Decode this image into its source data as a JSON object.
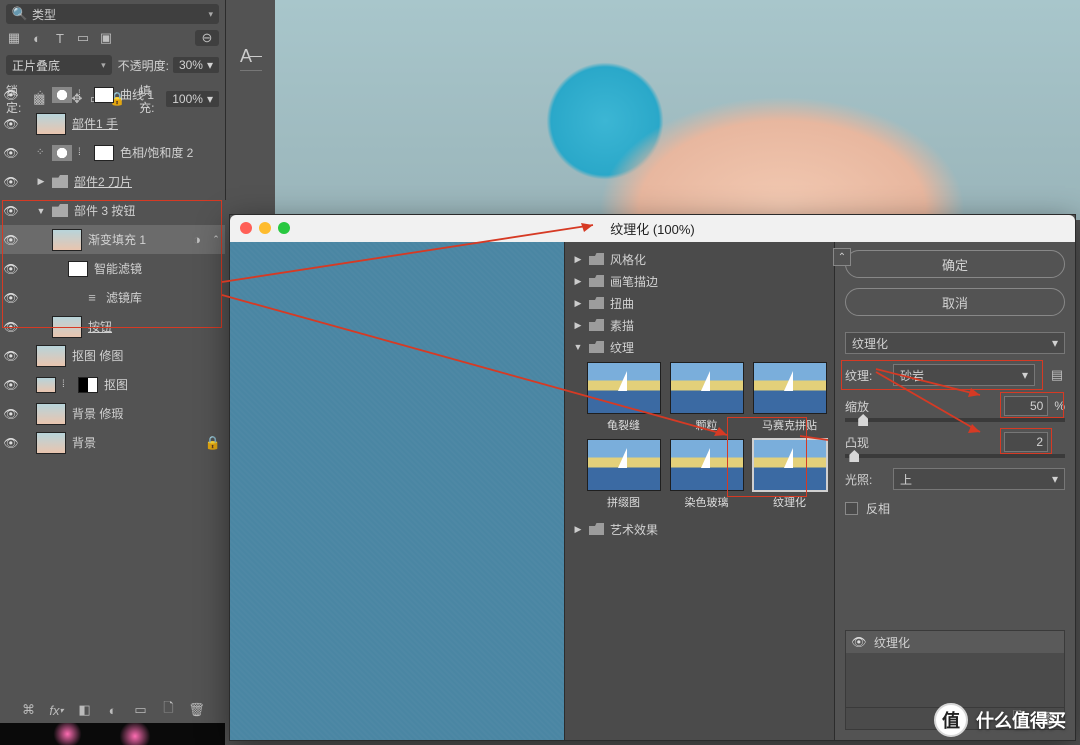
{
  "layers_panel": {
    "search_label": "类型",
    "blend_mode": "正片叠底",
    "opacity_label": "不透明度:",
    "opacity_value": "30%",
    "lock_label": "锁定:",
    "fill_label": "填充:",
    "fill_value": "100%",
    "layers": [
      {
        "name": "曲线 1",
        "kind": "adj",
        "indent": 0,
        "underline": false
      },
      {
        "name": "部件1 手",
        "kind": "smart",
        "indent": 0,
        "underline": true
      },
      {
        "name": "色相/饱和度 2",
        "kind": "adj",
        "indent": 0,
        "underline": false
      },
      {
        "name": "部件2 刀片",
        "kind": "group",
        "indent": 0,
        "underline": true,
        "caret": "▶"
      },
      {
        "name": "部件 3 按钮",
        "kind": "group",
        "indent": 0,
        "underline": false,
        "caret": "▼",
        "open": true
      },
      {
        "name": "渐变填充 1",
        "kind": "smart",
        "indent": 1,
        "underline": false,
        "sel": true,
        "smartbadge": true
      },
      {
        "name": "智能滤镜",
        "kind": "mask",
        "indent": 2,
        "underline": false
      },
      {
        "name": "滤镜库",
        "kind": "text",
        "indent": 3,
        "underline": false
      },
      {
        "name": "按钮",
        "kind": "smart",
        "indent": 1,
        "underline": true
      },
      {
        "name": "抠图 修图",
        "kind": "smart",
        "indent": 0,
        "underline": false
      },
      {
        "name": "抠图",
        "kind": "smartmask",
        "indent": 0,
        "underline": false
      },
      {
        "name": "背景 修瑕",
        "kind": "smart",
        "indent": 0,
        "underline": false
      },
      {
        "name": "背景",
        "kind": "smart",
        "indent": 0,
        "underline": false,
        "locked": true
      }
    ]
  },
  "dialog": {
    "title": "纹理化 (100%)",
    "buttons": {
      "ok": "确定",
      "cancel": "取消"
    },
    "categories": [
      {
        "label": "风格化"
      },
      {
        "label": "画笔描边"
      },
      {
        "label": "扭曲"
      },
      {
        "label": "素描"
      },
      {
        "label": "纹理",
        "open": true,
        "thumbs": [
          {
            "label": "龟裂缝"
          },
          {
            "label": "颗粒"
          },
          {
            "label": "马赛克拼贴"
          },
          {
            "label": "拼缀图"
          },
          {
            "label": "染色玻璃"
          },
          {
            "label": "纹理化",
            "sel": true
          }
        ]
      },
      {
        "label": "艺术效果"
      }
    ],
    "settings": {
      "filter_dropdown": "纹理化",
      "texture_label": "纹理:",
      "texture_value": "砂岩",
      "scale_label": "缩放",
      "scale_value": "50",
      "scale_suffix": "%",
      "relief_label": "凸现",
      "relief_value": "2",
      "light_label": "光照:",
      "light_value": "上",
      "invert_label": "反相"
    },
    "applied_label": "纹理化"
  },
  "watermark": {
    "glyph": "值",
    "text": "什么值得买"
  }
}
